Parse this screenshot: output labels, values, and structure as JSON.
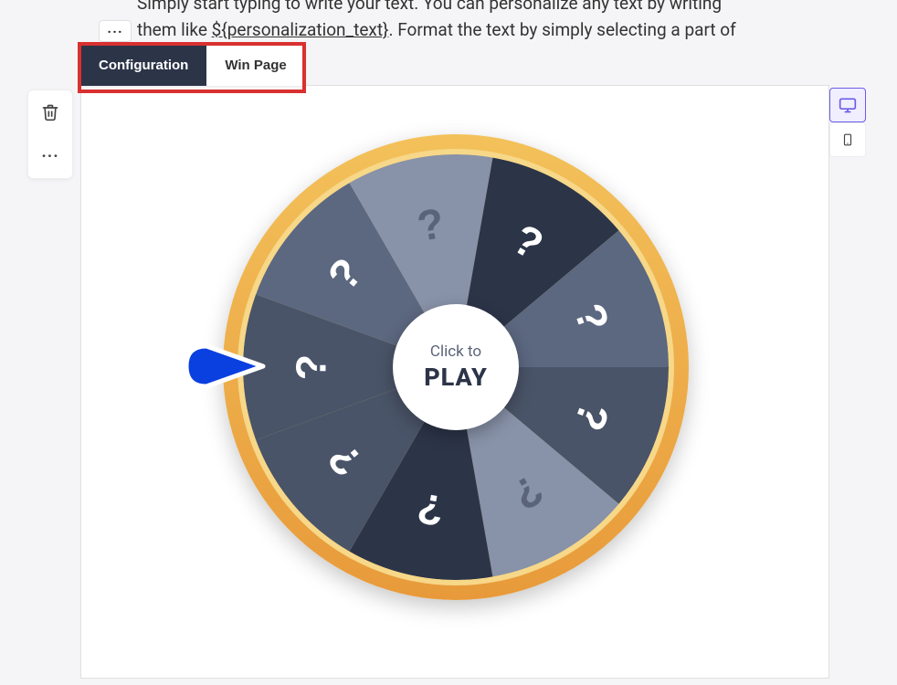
{
  "helpText": {
    "line1": "Simply start typing to write your text. You can personalize any text by writing",
    "line2_a": "them like ",
    "line2_b": "${personalization_text}",
    "line2_c": ". Format the text by simply selecting a part of"
  },
  "ellipsis": "···",
  "tabs": {
    "configuration": "Configuration",
    "winPage": "Win Page"
  },
  "hub": {
    "clickTo": "Click to",
    "play": "PLAY"
  },
  "wheel": {
    "ringColorTop": "#f3c15a",
    "ringColorBottom": "#e89a3a",
    "pointerColor": "#0a3fe0",
    "segments": [
      {
        "color": "#4a5468",
        "label": "?"
      },
      {
        "color": "#5c6880",
        "label": "?"
      },
      {
        "color": "#8892a8",
        "label": "?"
      },
      {
        "color": "#2c3448",
        "label": "?"
      },
      {
        "color": "#5c6880",
        "label": "?"
      },
      {
        "color": "#4a5468",
        "label": "?"
      },
      {
        "color": "#8892a8",
        "label": "?"
      },
      {
        "color": "#2c3448",
        "label": "?"
      },
      {
        "color": "#4a5468",
        "label": "?"
      }
    ]
  }
}
